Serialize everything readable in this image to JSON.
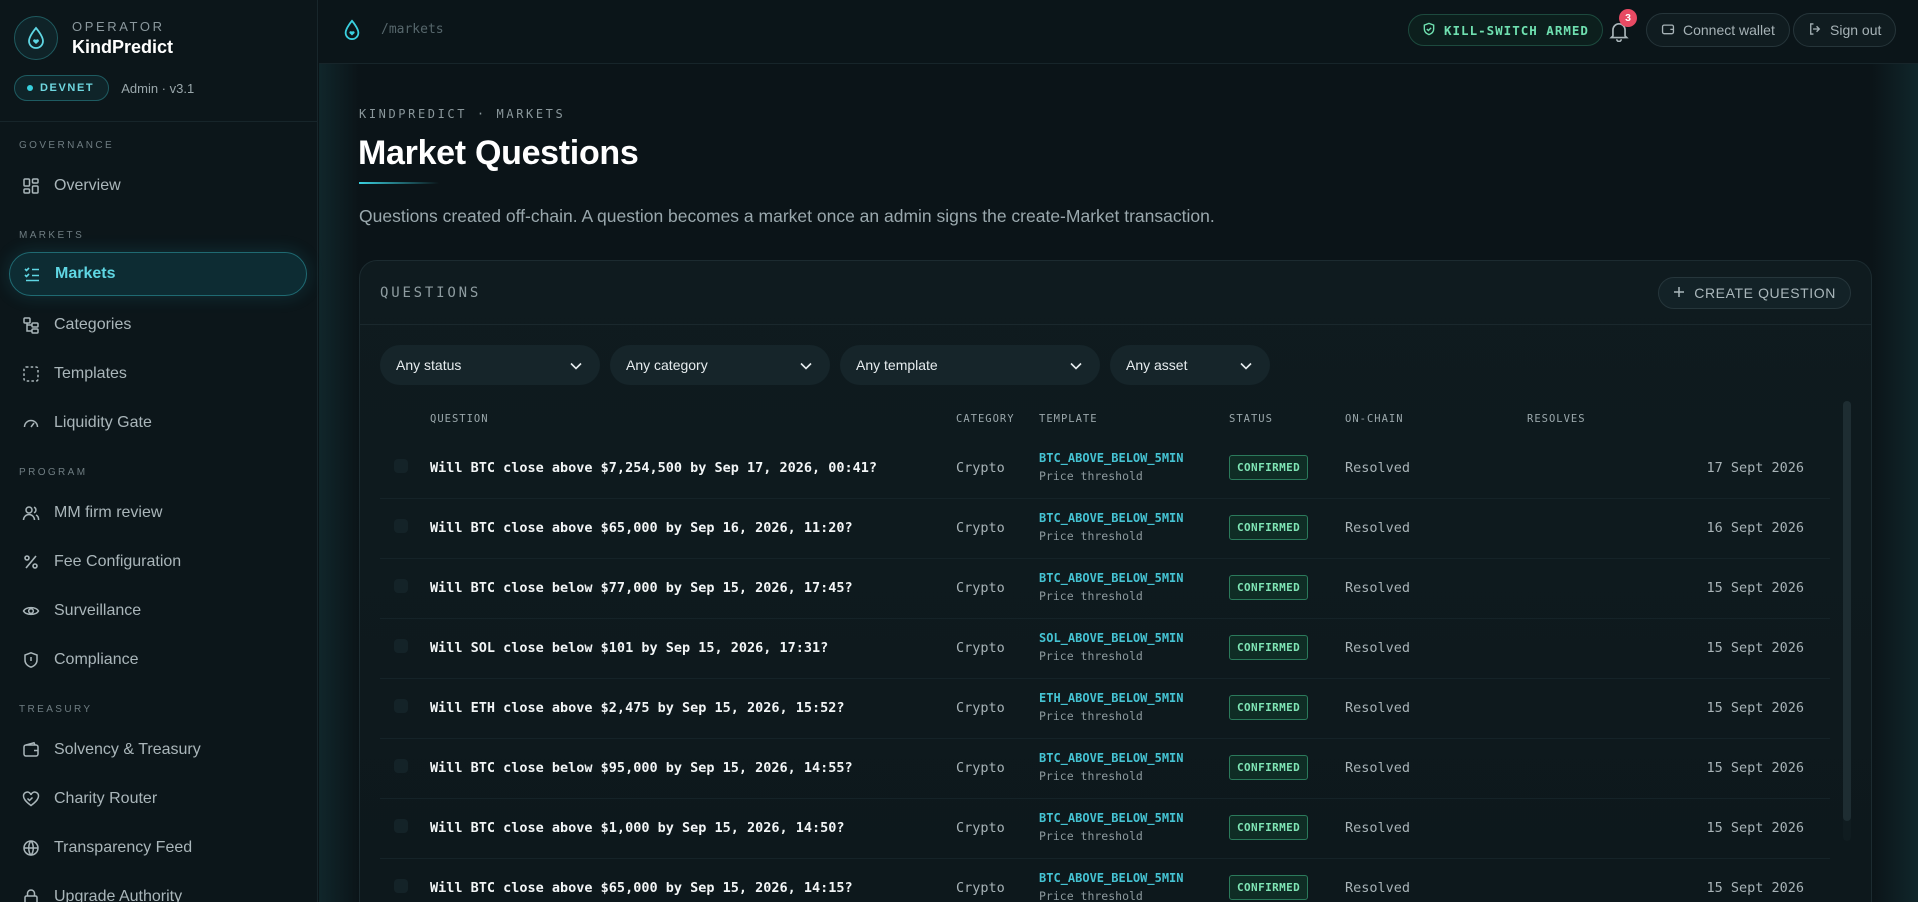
{
  "brand": {
    "operator": "OPERATOR",
    "name": "KindPredict",
    "env": "DEVNET",
    "admin_version": "Admin · v3.1"
  },
  "sidebar": {
    "sections": [
      {
        "label": "GOVERNANCE"
      },
      {
        "label": "MARKETS"
      },
      {
        "label": "PROGRAM"
      },
      {
        "label": "TREASURY"
      }
    ],
    "items": [
      {
        "label": "Overview",
        "icon": "grid-icon"
      },
      {
        "label": "Markets",
        "icon": "list-check-icon",
        "active": true
      },
      {
        "label": "Categories",
        "icon": "hierarchy-icon"
      },
      {
        "label": "Templates",
        "icon": "dashed-square-icon"
      },
      {
        "label": "Liquidity Gate",
        "icon": "gauge-icon"
      },
      {
        "label": "MM firm review",
        "icon": "users-icon"
      },
      {
        "label": "Fee Configuration",
        "icon": "percent-icon"
      },
      {
        "label": "Surveillance",
        "icon": "eye-icon"
      },
      {
        "label": "Compliance",
        "icon": "shield-icon"
      },
      {
        "label": "Solvency & Treasury",
        "icon": "wallet-icon"
      },
      {
        "label": "Charity Router",
        "icon": "heart-icon"
      },
      {
        "label": "Transparency Feed",
        "icon": "globe-icon"
      },
      {
        "label": "Upgrade Authority",
        "icon": "lock-icon"
      }
    ]
  },
  "topbar": {
    "path": "/markets",
    "kill_switch": "KILL-SWITCH ARMED",
    "notifications": "3",
    "connect_wallet": "Connect wallet",
    "sign_out": "Sign out"
  },
  "page": {
    "breadcrumb": "KINDPREDICT · MARKETS",
    "title": "Market Questions",
    "subtitle": "Questions created off-chain. A question becomes a market once an admin signs the create-Market transaction."
  },
  "panel": {
    "label": "QUESTIONS",
    "create_button": "CREATE QUESTION",
    "filters": [
      "Any status",
      "Any category",
      "Any template",
      "Any asset"
    ],
    "columns": [
      "QUESTION",
      "CATEGORY",
      "TEMPLATE",
      "STATUS",
      "ON-CHAIN",
      "RESOLVES"
    ],
    "rows": [
      {
        "question": "Will BTC close above $7,254,500 by Sep 17, 2026, 00:41?",
        "category": "Crypto",
        "template": "BTC_ABOVE_BELOW_5MIN",
        "template_sub": "Price threshold",
        "status": "CONFIRMED",
        "onchain": "Resolved",
        "resolves": "17 Sept 2026"
      },
      {
        "question": "Will BTC close above $65,000 by Sep 16, 2026, 11:20?",
        "category": "Crypto",
        "template": "BTC_ABOVE_BELOW_5MIN",
        "template_sub": "Price threshold",
        "status": "CONFIRMED",
        "onchain": "Resolved",
        "resolves": "16 Sept 2026"
      },
      {
        "question": "Will BTC close below $77,000 by Sep 15, 2026, 17:45?",
        "category": "Crypto",
        "template": "BTC_ABOVE_BELOW_5MIN",
        "template_sub": "Price threshold",
        "status": "CONFIRMED",
        "onchain": "Resolved",
        "resolves": "15 Sept 2026"
      },
      {
        "question": "Will SOL close below $101 by Sep 15, 2026, 17:31?",
        "category": "Crypto",
        "template": "SOL_ABOVE_BELOW_5MIN",
        "template_sub": "Price threshold",
        "status": "CONFIRMED",
        "onchain": "Resolved",
        "resolves": "15 Sept 2026"
      },
      {
        "question": "Will ETH close above $2,475 by Sep 15, 2026, 15:52?",
        "category": "Crypto",
        "template": "ETH_ABOVE_BELOW_5MIN",
        "template_sub": "Price threshold",
        "status": "CONFIRMED",
        "onchain": "Resolved",
        "resolves": "15 Sept 2026"
      },
      {
        "question": "Will BTC close below $95,000 by Sep 15, 2026, 14:55?",
        "category": "Crypto",
        "template": "BTC_ABOVE_BELOW_5MIN",
        "template_sub": "Price threshold",
        "status": "CONFIRMED",
        "onchain": "Resolved",
        "resolves": "15 Sept 2026"
      },
      {
        "question": "Will BTC close above $1,000 by Sep 15, 2026, 14:50?",
        "category": "Crypto",
        "template": "BTC_ABOVE_BELOW_5MIN",
        "template_sub": "Price threshold",
        "status": "CONFIRMED",
        "onchain": "Resolved",
        "resolves": "15 Sept 2026"
      },
      {
        "question": "Will BTC close above $65,000 by Sep 15, 2026, 14:15?",
        "category": "Crypto",
        "template": "BTC_ABOVE_BELOW_5MIN",
        "template_sub": "Price threshold",
        "status": "CONFIRMED",
        "onchain": "Resolved",
        "resolves": "15 Sept 2026"
      }
    ]
  },
  "colors": {
    "accent": "#3ad0df",
    "confirmed": "#7fe5b5",
    "badge": "#e84a63",
    "background": "#0b1418"
  }
}
